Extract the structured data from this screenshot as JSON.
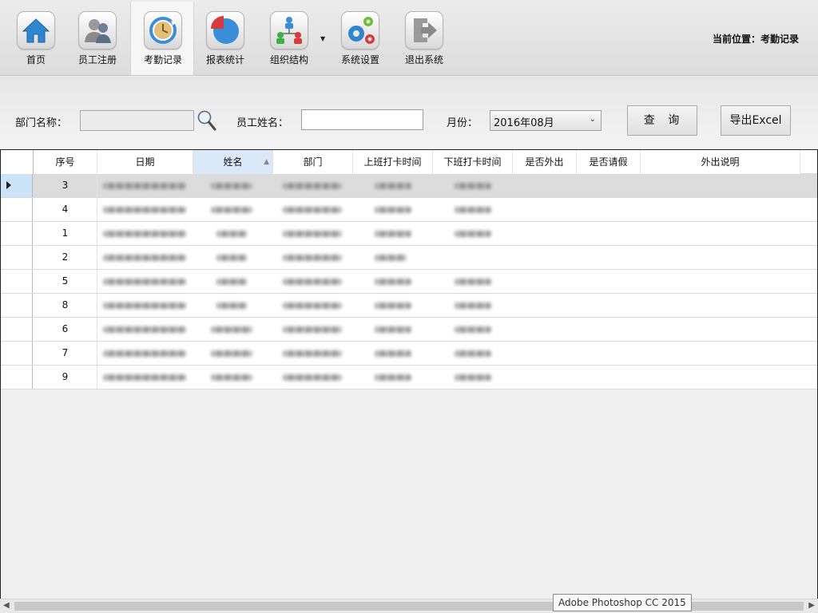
{
  "toolbar": {
    "items": [
      {
        "label": "首页",
        "icon": "home-icon"
      },
      {
        "label": "员工注册",
        "icon": "users-icon"
      },
      {
        "label": "考勤记录",
        "icon": "clock-icon"
      },
      {
        "label": "报表统计",
        "icon": "pie-chart-icon"
      },
      {
        "label": "组织结构",
        "icon": "org-chart-icon"
      },
      {
        "label": "系统设置",
        "icon": "gears-icon"
      },
      {
        "label": "退出系统",
        "icon": "exit-icon"
      }
    ],
    "active_index": 2,
    "location_label": "当前位置：",
    "location_value": "考勤记录"
  },
  "filter": {
    "dept_label": "部门名称：",
    "dept_value": "",
    "name_label": "员工姓名：",
    "name_value": "",
    "month_label": "月份：",
    "month_value": "2016年08月",
    "query_label": "查 询",
    "export_label": "导出Excel"
  },
  "grid": {
    "columns": [
      "序号",
      "日期",
      "姓名",
      "部门",
      "上班打卡时间",
      "下班打卡时间",
      "是否外出",
      "是否请假",
      "外出说明"
    ],
    "sorted_column": 2,
    "rows": [
      {
        "seq": "3"
      },
      {
        "seq": "4"
      },
      {
        "seq": "1"
      },
      {
        "seq": "2"
      },
      {
        "seq": "5"
      },
      {
        "seq": "8"
      },
      {
        "seq": "6"
      },
      {
        "seq": "7"
      },
      {
        "seq": "9"
      }
    ],
    "selected_row": 0
  },
  "tooltip": "Adobe Photoshop CC 2015",
  "colors": {
    "accent_blue": "#3a8ed8",
    "selected_header": "#dbe8f7",
    "selected_row": "#dcdcdc"
  }
}
